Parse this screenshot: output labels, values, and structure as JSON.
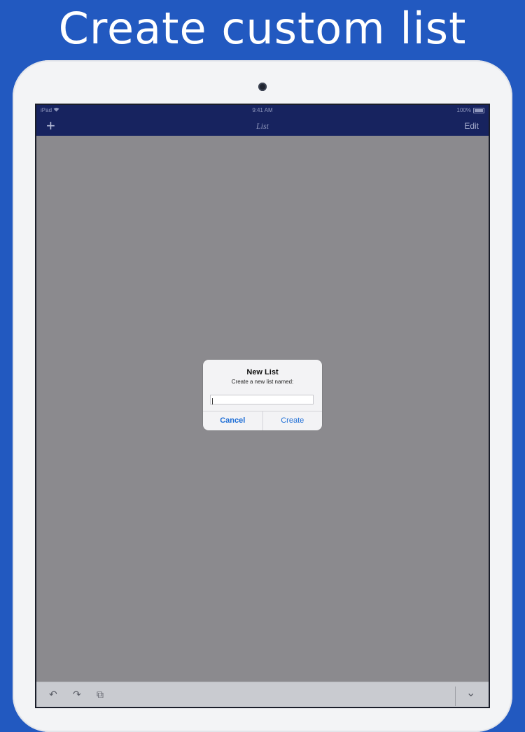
{
  "headline": "Create custom list",
  "status_bar": {
    "carrier": "iPad",
    "wifi_icon": "wifi-icon",
    "time": "9:41 AM",
    "battery_percent": "100%"
  },
  "nav_bar": {
    "add_icon": "+",
    "title": "List",
    "edit_label": "Edit"
  },
  "alert": {
    "title": "New List",
    "message": "Create a new list named:",
    "input_value": "",
    "cancel_label": "Cancel",
    "create_label": "Create"
  },
  "toolbar": {
    "undo_icon": "↶",
    "redo_icon": "↷",
    "copy_icon": "⧉",
    "collapse_icon": "⌄"
  },
  "colors": {
    "background": "#2259c0",
    "nav_bar": "#17235f",
    "dim_overlay": "#8b8a8e",
    "accent": "#1e6ed6"
  }
}
